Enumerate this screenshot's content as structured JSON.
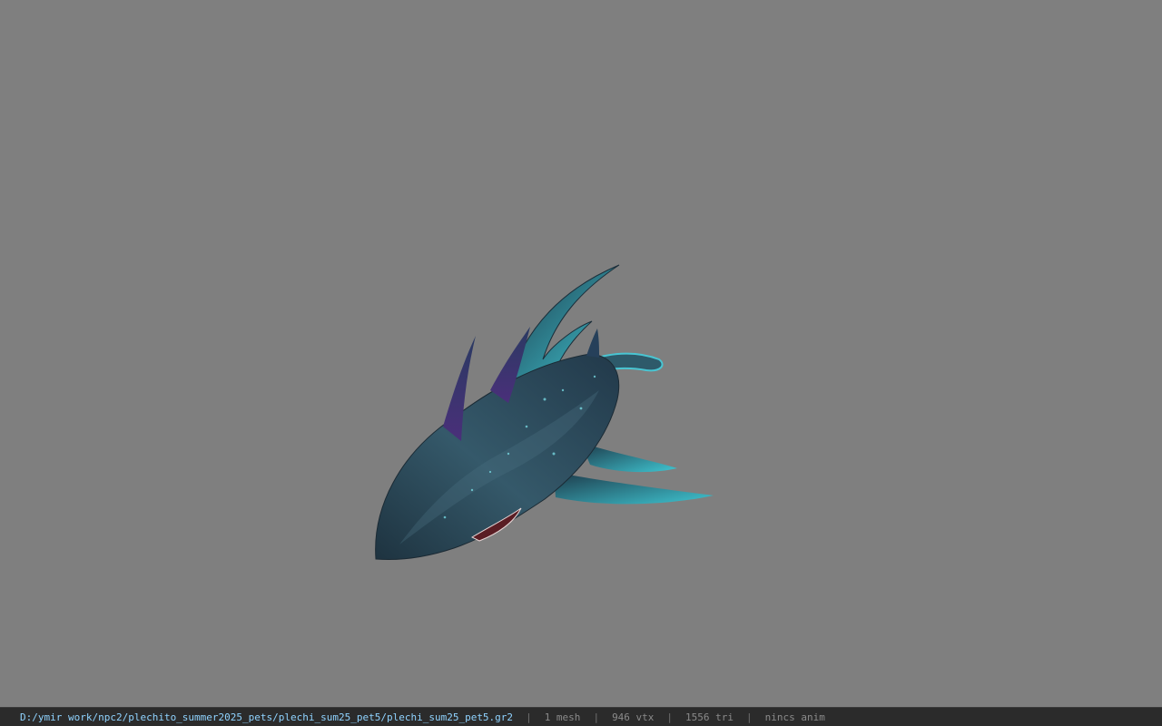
{
  "viewer": {
    "background_color": "#7f7f7f",
    "model_subject": "shark-creature"
  },
  "status": {
    "file_path": "D:/ymir work/npc2/plechito_summer2025_pets/plechi_sum25_pet5/plechi_sum25_pet5.gr2",
    "separator": "|",
    "mesh": "1 mesh",
    "vertices": "946 vtx",
    "triangles": "1556 tri",
    "animation": "nincs anim"
  },
  "colors": {
    "status_bg": "#2b2b2b",
    "path_text": "#8fd3ff",
    "stat_text": "#8a8a8a",
    "body_dark": "#233a48",
    "body_mid": "#2f5262",
    "fin_cyan": "#3fd0d8",
    "spike_purple": "#3a2f6a"
  }
}
